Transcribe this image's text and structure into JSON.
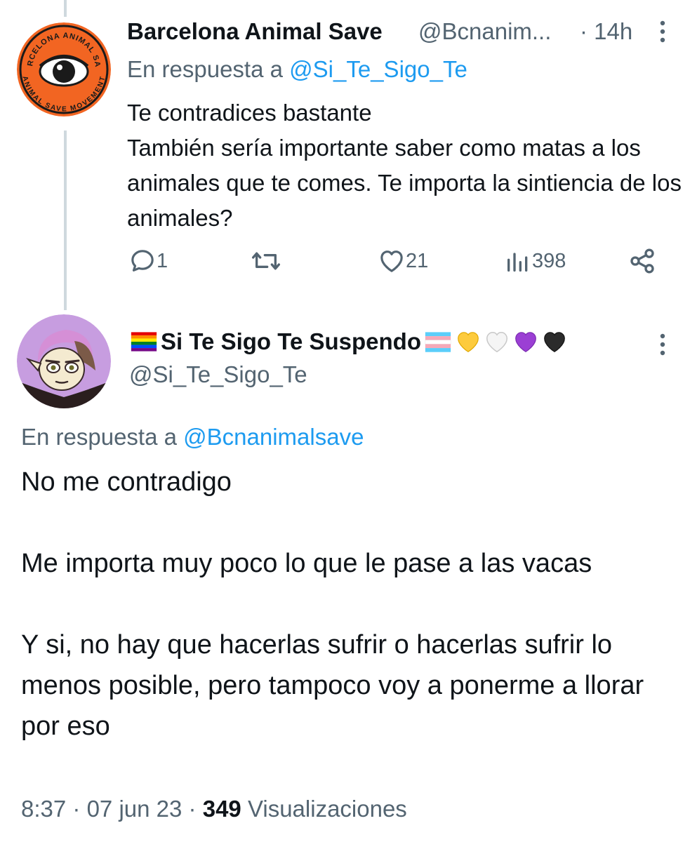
{
  "tweet1": {
    "author_name": "Barcelona Animal Save",
    "handle": "@Bcnanim...",
    "time": "· 14h",
    "reply_prefix": "En respuesta a",
    "reply_mention": "@Si_Te_Sigo_Te",
    "body_lines": [
      "Te contradices bastante",
      "También sería importante saber como matas a los animales que te comes. Te importa la sintiencia de los animales?"
    ],
    "avatar_text_top": "BARCELONA ANIMAL SAVE",
    "avatar_text_bottom": "ANIMAL SAVE MOVEMENT",
    "stats": {
      "replies": "1",
      "retweets": "",
      "likes": "21",
      "views": "398"
    }
  },
  "tweet2": {
    "author_name": "Si Te Sigo Te Suspendo",
    "handle": "@Si_Te_Sigo_Te",
    "name_emojis": [
      "rainbow-flag",
      "transgender-flag",
      "yellow-heart",
      "white-heart",
      "purple-heart",
      "black-heart"
    ],
    "reply_prefix": "En respuesta a",
    "reply_mention": "@Bcnanimalsave",
    "paragraphs": [
      "No me contradigo",
      "Me importa muy poco lo que le pase a las vacas",
      "Y si, no hay que hacerlas sufrir o hacerlas sufrir lo menos posible, pero tampoco voy a ponerme a llorar por eso"
    ],
    "time": "8:37",
    "date": "07 jun 23",
    "views_count": "349",
    "views_label": "Visualizaciones"
  },
  "colors": {
    "text": "#0f1419",
    "secondary": "#536471",
    "link": "#1d9bf0",
    "thread_line": "#cfd9de"
  }
}
